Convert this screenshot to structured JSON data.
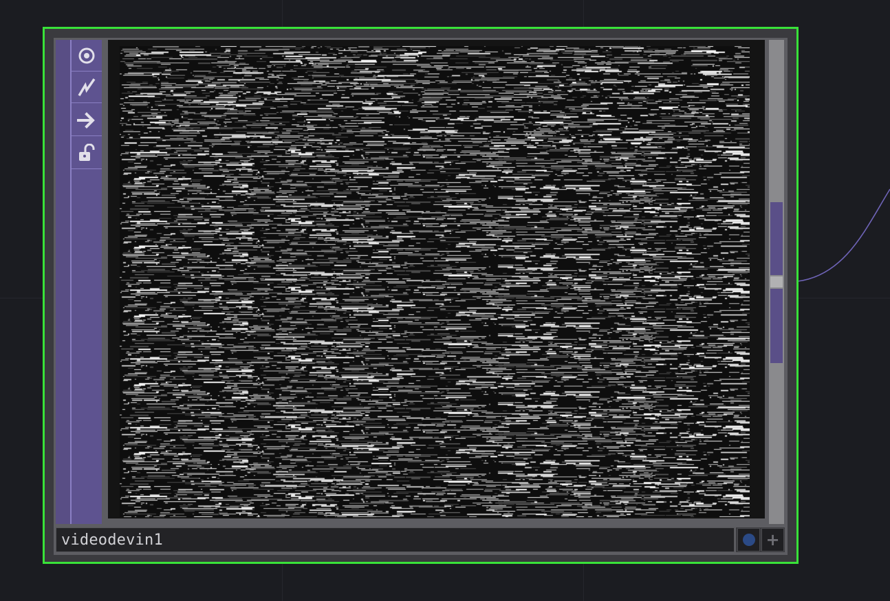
{
  "network": {
    "background": "#1b1c21",
    "grid_color": "#26272d",
    "wire_color": "#6f64b8"
  },
  "node": {
    "name": "videodevin1",
    "selected_border_color": "#39e239",
    "family_color": "#594e85",
    "flags": [
      {
        "name": "viewer-active-flag",
        "icon": "viewer-icon"
      },
      {
        "name": "bypass-flag",
        "icon": "bypass-icon"
      },
      {
        "name": "display-flag",
        "icon": "arrow-icon"
      },
      {
        "name": "lock-flag",
        "icon": "unlock-icon"
      }
    ],
    "viewer_content": "noise-static",
    "footer_buttons": [
      {
        "name": "cook-indicator",
        "icon": "blue-dot-icon"
      },
      {
        "name": "expand-button",
        "icon": "plus-icon"
      }
    ]
  }
}
